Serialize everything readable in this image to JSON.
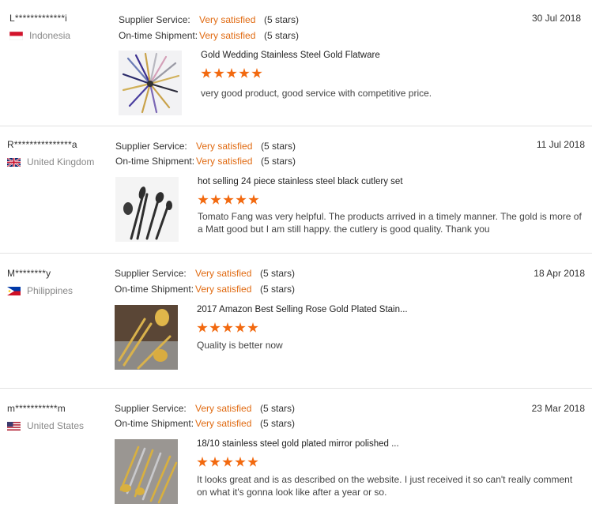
{
  "labels": {
    "supplier_service": "Supplier Service:",
    "ontime_shipment": "On-time Shipment:"
  },
  "reviews": [
    {
      "reviewer": "L*************i",
      "country": "Indonesia",
      "flag_icon": "indonesia-flag-icon",
      "supplier_rating": "Very satisfied",
      "supplier_stars": "(5 stars)",
      "shipment_rating": "Very satisfied",
      "shipment_stars": "(5 stars)",
      "date": "30 Jul 2018",
      "product": "Gold Wedding Stainless Steel Gold Flatware",
      "rating": 5,
      "comment": "very good product, good service with competitive price."
    },
    {
      "reviewer": "R***************a",
      "country": "United Kingdom",
      "flag_icon": "united-kingdom-flag-icon",
      "supplier_rating": "Very satisfied",
      "supplier_stars": "(5 stars)",
      "shipment_rating": "Very satisfied",
      "shipment_stars": "(5 stars)",
      "date": "11 Jul 2018",
      "product": "hot selling 24 piece stainless steel black cutlery set",
      "rating": 5,
      "comment": "Tomato Fang was very helpful. The products arrived in a timely manner. The gold is more of a Matt good but I am still happy. the cutlery is good quality. Thank you"
    },
    {
      "reviewer": "M********y",
      "country": "Philippines",
      "flag_icon": "philippines-flag-icon",
      "supplier_rating": "Very satisfied",
      "supplier_stars": "(5 stars)",
      "shipment_rating": "Very satisfied",
      "shipment_stars": "(5 stars)",
      "date": "18 Apr 2018",
      "product": "2017 Amazon Best Selling Rose Gold Plated Stain...",
      "rating": 5,
      "comment": "Quality is better now"
    },
    {
      "reviewer": "m***********m",
      "country": "United States",
      "flag_icon": "united-states-flag-icon",
      "supplier_rating": "Very satisfied",
      "supplier_stars": "(5 stars)",
      "shipment_rating": "Very satisfied",
      "shipment_stars": "(5 stars)",
      "date": "23 Mar 2018",
      "product": "18/10 stainless steel gold plated mirror polished ...",
      "rating": 5,
      "comment": "It looks great and is as described on the website. I just received it so can't really comment on what it's gonna look like after a year or so."
    }
  ],
  "colors": {
    "accent": "#e06a11",
    "star": "#f2690f"
  }
}
